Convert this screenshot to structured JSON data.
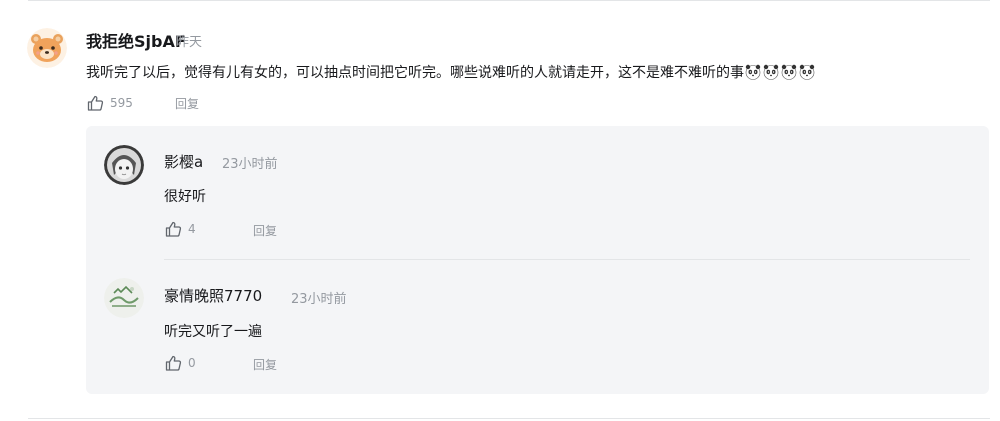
{
  "comment": {
    "username": "我拒绝SjbAF",
    "time": "昨天",
    "content": "我听完了以后，觉得有儿有女的，可以抽点时间把它听完。哪些说难听的人就请走开，这不是难不难听的事",
    "emoji_icons": [
      "panda-icon",
      "panda-icon",
      "panda-icon",
      "panda-icon"
    ],
    "likes": "595",
    "reply_label": "回复"
  },
  "replies": [
    {
      "username": "影樱a",
      "time": "23小时前",
      "content": "很好听",
      "likes": "4",
      "reply_label": "回复"
    },
    {
      "username": "豪情晚照7770",
      "time": "23小时前",
      "content": "听完又听了一遍",
      "likes": "0",
      "reply_label": "回复"
    }
  ],
  "colors": {
    "text": "#18191c",
    "meta": "#9499a0",
    "panel": "#f4f5f7",
    "divider": "#e3e5e7"
  }
}
